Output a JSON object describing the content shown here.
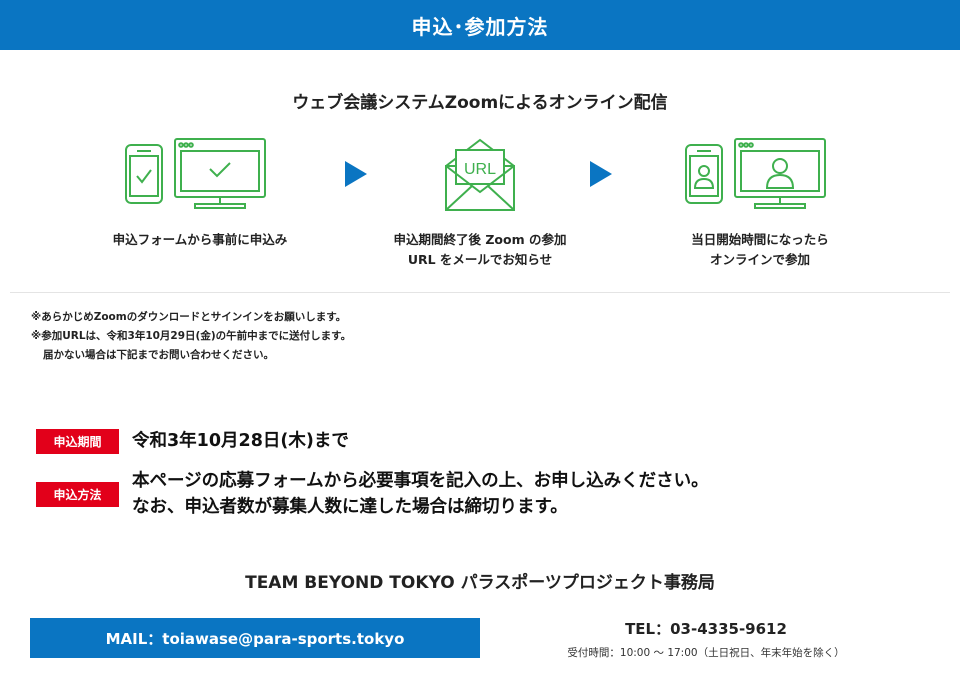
{
  "header": {
    "title": "申込･参加方法"
  },
  "subtitle": "ウェブ会議システムZoomによるオンライン配信",
  "steps": [
    {
      "icon": "phone-monitor-check-icon",
      "label_lines": [
        "申込フォームから事前に申込み"
      ]
    },
    {
      "icon": "envelope-url-icon",
      "label_lines": [
        "申込期間終了後 Zoom の参加",
        "URL をメールでお知らせ"
      ]
    },
    {
      "icon": "phone-monitor-person-icon",
      "label_lines": [
        "当日開始時間になったら",
        "オンラインで参加"
      ]
    }
  ],
  "envelope_text": "URL",
  "notes": [
    "※あらかじめZoomのダウンロードとサインインをお願いします。",
    "※参加URLは、令和3年10月29日(金)の午前中までに送付します。",
    "届かない場合は下記までお問い合わせください。"
  ],
  "period": {
    "badge": "申込期間",
    "text": "令和3年10月28日(木)まで"
  },
  "method": {
    "badge": "申込方法",
    "lines": [
      "本ページの応募フォームから必要事項を記入の上、お申し込みください。",
      "なお、申込者数が募集人数に達した場合は締切ります。"
    ]
  },
  "contact": {
    "org": "TEAM BEYOND TOKYO パラスポーツプロジェクト事務局",
    "mail": "MAIL：toiawase@para-sports.tokyo",
    "tel": "TEL：03-4335-9612",
    "hours": "受付時間：10:00 ～ 17:00（土日祝日、年末年始を除く）"
  },
  "colors": {
    "header_blue": "#0a75c2",
    "badge_red": "#e2001a",
    "icon_green": "#3fb04e"
  }
}
